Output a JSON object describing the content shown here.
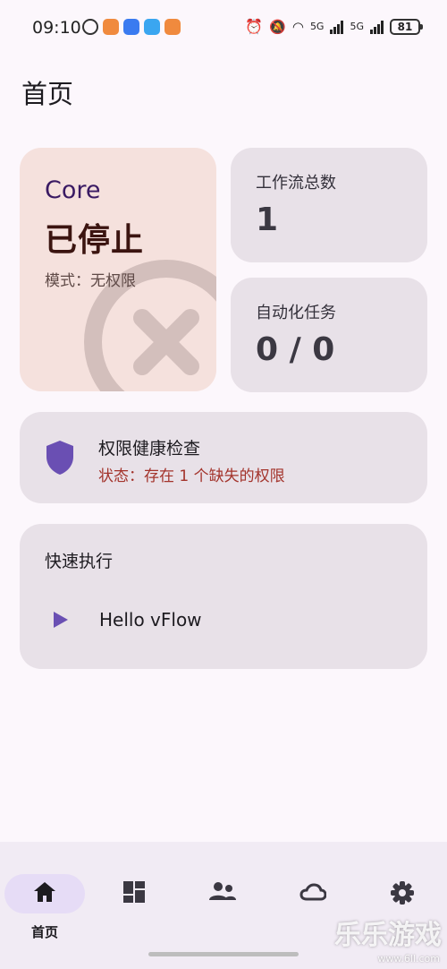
{
  "status_bar": {
    "time": "09:10",
    "network_label_1": "5G",
    "network_label_2": "5G",
    "battery": "81"
  },
  "page": {
    "title": "首页"
  },
  "core_card": {
    "label": "Core",
    "status": "已停止",
    "mode": "模式：无权限"
  },
  "stats": {
    "workflows": {
      "label": "工作流总数",
      "value": "1"
    },
    "tasks": {
      "label": "自动化任务",
      "value": "0 / 0"
    }
  },
  "health_card": {
    "title": "权限健康检查",
    "status": "状态：存在 1 个缺失的权限"
  },
  "quick_run": {
    "title": "快速执行",
    "items": [
      {
        "label": "Hello vFlow"
      }
    ]
  },
  "bottom_nav": {
    "items": [
      {
        "id": "home",
        "label": "首页",
        "icon": "home-icon",
        "active": true
      },
      {
        "id": "workflows",
        "icon": "dashboard-icon"
      },
      {
        "id": "modules",
        "icon": "people-icon"
      },
      {
        "id": "cloud",
        "icon": "cloud-icon"
      },
      {
        "id": "settings",
        "icon": "gear-icon"
      }
    ]
  },
  "watermark": {
    "text": "乐乐游戏",
    "url": "www.6ll.com"
  },
  "colors": {
    "background": "#fcf7fc",
    "core_card": "#f5e1dd",
    "card": "#e8e1e8",
    "accent": "#6a4fb3",
    "error": "#a3332b",
    "nav_active": "#e6dcf6"
  }
}
